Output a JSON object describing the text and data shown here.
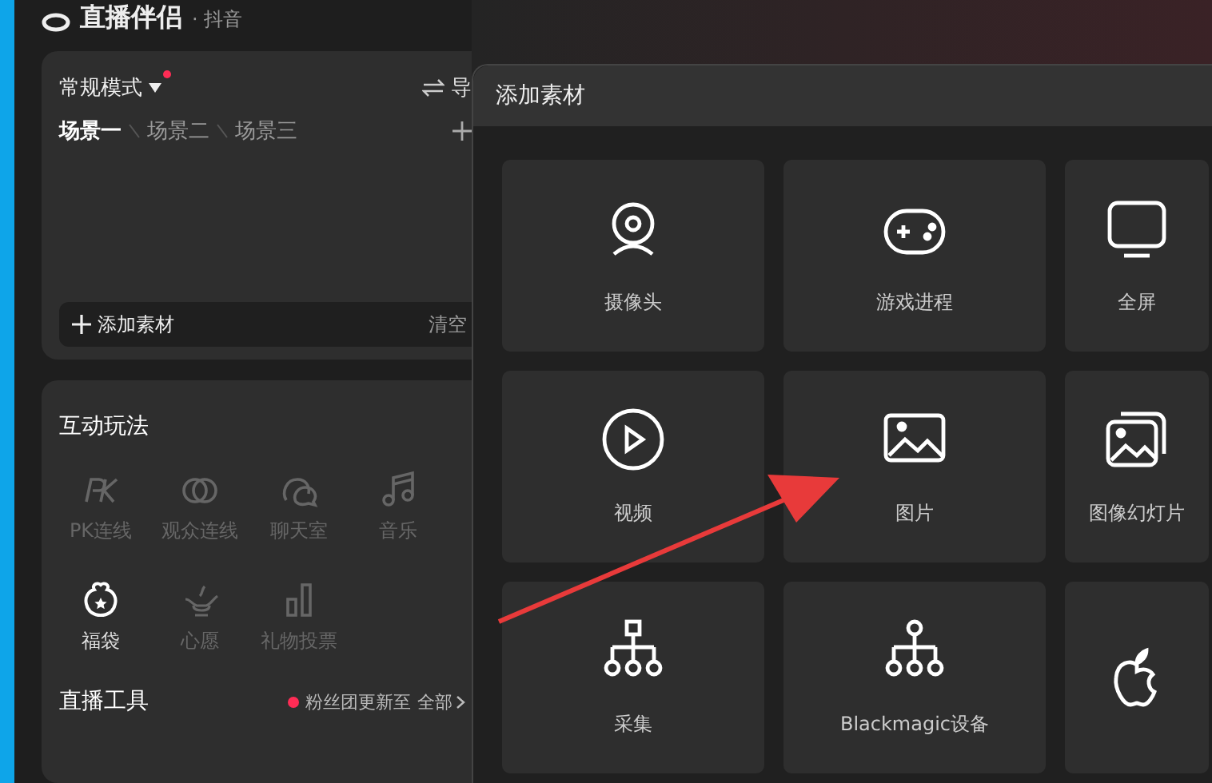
{
  "app": {
    "title": "直播伴侣",
    "platform": "· 抖音"
  },
  "scene_panel": {
    "mode": "常规模式",
    "mode_badge": true,
    "import_label": "导",
    "scenes": [
      {
        "label": "场景一",
        "selected": true
      },
      {
        "label": "场景二",
        "selected": false
      },
      {
        "label": "场景三",
        "selected": false
      }
    ],
    "add_label": "添加素材",
    "clear_label": "清空"
  },
  "interactive": {
    "title": "互动玩法",
    "items": [
      {
        "label": "PK连线",
        "disabled": true
      },
      {
        "label": "观众连线",
        "disabled": true
      },
      {
        "label": "聊天室",
        "disabled": true
      },
      {
        "label": "音乐",
        "disabled": true
      },
      {
        "label": "福袋",
        "disabled": false
      },
      {
        "label": "心愿",
        "disabled": true
      },
      {
        "label": "礼物投票",
        "disabled": true
      }
    ]
  },
  "tools": {
    "title": "直播工具",
    "notice_dot": true,
    "notice": "粉丝团更新至",
    "all_label": "全部"
  },
  "dialog": {
    "title": "添加素材",
    "tiles": [
      {
        "kind": "labeled",
        "label": "摄像头"
      },
      {
        "kind": "labeled",
        "label": "游戏进程"
      },
      {
        "kind": "labeled",
        "label": "全屏"
      },
      {
        "kind": "labeled",
        "label": "视频"
      },
      {
        "kind": "labeled",
        "label": "图片"
      },
      {
        "kind": "labeled",
        "label": "图像幻灯片"
      },
      {
        "kind": "labeled",
        "label": "采集"
      },
      {
        "kind": "labeled",
        "label": "Blackmagic设备"
      },
      {
        "kind": "icon_only"
      }
    ]
  }
}
